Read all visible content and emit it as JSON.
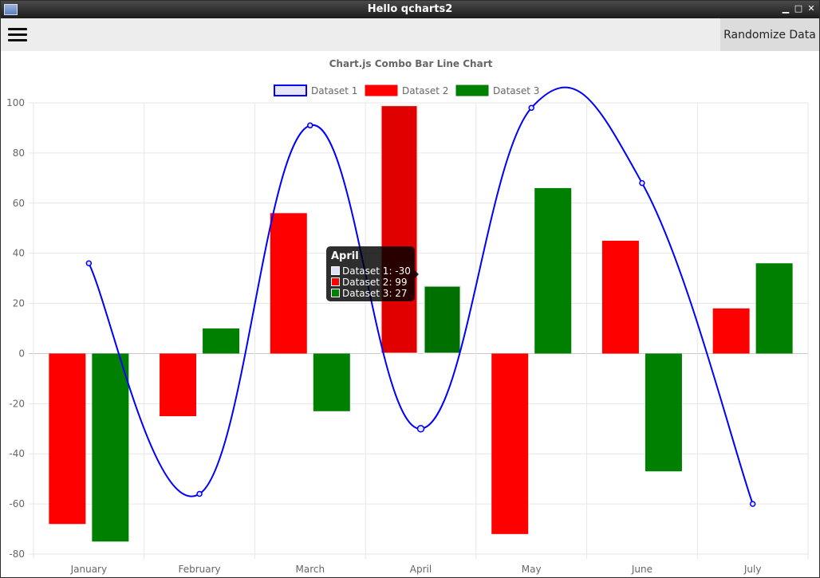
{
  "window": {
    "title": "Hello qcharts2"
  },
  "toolbar": {
    "menu_icon": "hamburger-menu-icon",
    "randomize_label": "Randomize Data"
  },
  "colors": {
    "dataset1": "#0000ff",
    "dataset2": "#ff0000",
    "dataset3": "#008000",
    "grid": "#e6e6e6",
    "text": "#666666"
  },
  "chart_data": {
    "type": "bar",
    "title": "Chart.js Combo Bar Line Chart",
    "categories": [
      "January",
      "February",
      "March",
      "April",
      "May",
      "June",
      "July"
    ],
    "ylim": [
      -80,
      100
    ],
    "yticks": [
      100,
      80,
      60,
      40,
      20,
      0,
      -20,
      -40,
      -60,
      -80
    ],
    "grid": true,
    "legend_position": "top",
    "series": [
      {
        "name": "Dataset 1",
        "type": "line",
        "color": "#0000ff",
        "values": [
          36,
          -56,
          91,
          -30,
          98,
          68,
          -60
        ]
      },
      {
        "name": "Dataset 2",
        "type": "bar",
        "color": "#ff0000",
        "values": [
          -68,
          -25,
          56,
          99,
          -72,
          45,
          18
        ]
      },
      {
        "name": "Dataset 3",
        "type": "bar",
        "color": "#008000",
        "values": [
          -75,
          10,
          -23,
          27,
          66,
          -47,
          36
        ]
      }
    ],
    "tooltip": {
      "title": "April",
      "rows": [
        "Dataset 1: -30",
        "Dataset 2: 99",
        "Dataset 3: 27"
      ]
    }
  }
}
